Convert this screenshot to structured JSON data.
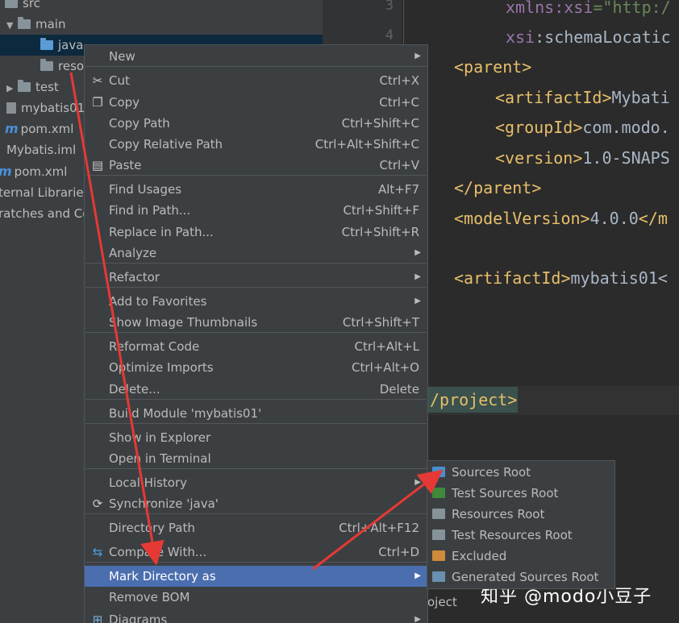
{
  "project_tree": {
    "items": [
      {
        "label": "src",
        "icon": "folder-icon"
      },
      {
        "label": "main",
        "icon": "folder-icon",
        "expanded": true
      },
      {
        "label": "java",
        "icon": "source-folder-icon",
        "selected": true
      },
      {
        "label": "reso",
        "icon": "folder-icon"
      },
      {
        "label": "test",
        "icon": "folder-icon",
        "expanded": false
      },
      {
        "label": "mybatis01",
        "icon": "file-icon"
      },
      {
        "label": "pom.xml",
        "icon": "maven-icon"
      },
      {
        "label": "Mybatis.iml",
        "icon": "iml-file-icon"
      },
      {
        "label": "pom.xml",
        "icon": "maven-icon"
      },
      {
        "label": "ternal Libraries",
        "icon": ""
      },
      {
        "label": "ratches and Co",
        "icon": ""
      }
    ]
  },
  "editor": {
    "line_numbers": [
      "3",
      "4"
    ],
    "lines": [
      {
        "parts": [
          {
            "t": "xmlns:",
            "c": "ns"
          },
          {
            "t": "xsi",
            "c": "ns"
          },
          {
            "t": "=\"http:/",
            "c": "str"
          }
        ]
      },
      {
        "parts": [
          {
            "t": "xsi",
            "c": "ns"
          },
          {
            "t": ":schemaLocatic",
            "c": "txt"
          }
        ]
      },
      {
        "parts": [
          {
            "t": "<parent>",
            "c": "tag"
          }
        ]
      },
      {
        "parts": [
          {
            "t": "<artifactId>",
            "c": "tag"
          },
          {
            "t": "Mybati",
            "c": "txt"
          }
        ]
      },
      {
        "parts": [
          {
            "t": "<groupId>",
            "c": "tag"
          },
          {
            "t": "com.modo.",
            "c": "txt"
          }
        ]
      },
      {
        "parts": [
          {
            "t": "<version>",
            "c": "tag"
          },
          {
            "t": "1.0-SNAPS",
            "c": "txt"
          }
        ]
      },
      {
        "parts": [
          {
            "t": "</parent>",
            "c": "tag"
          }
        ]
      },
      {
        "parts": [
          {
            "t": "<modelVersion>",
            "c": "tag"
          },
          {
            "t": "4.0.0",
            "c": "txt"
          },
          {
            "t": "</m",
            "c": "tag"
          }
        ]
      },
      {
        "parts": [
          {
            "t": "<artifactId>",
            "c": "tag"
          },
          {
            "t": "mybatis01<",
            "c": "txt"
          }
        ]
      },
      {
        "parts": [
          {
            "t": "/project>",
            "c": "tag"
          }
        ]
      }
    ],
    "bottom_label": "oject",
    "watermark": "知乎 @modo小豆子"
  },
  "context_menu": {
    "items": [
      {
        "label": "New",
        "shortcut": "",
        "submenu": true,
        "icon": ""
      },
      {
        "label": "Cut",
        "shortcut": "Ctrl+X",
        "icon": "scissors-icon"
      },
      {
        "label": "Copy",
        "shortcut": "Ctrl+C",
        "icon": "copy-icon"
      },
      {
        "label": "Copy Path",
        "shortcut": "Ctrl+Shift+C",
        "icon": ""
      },
      {
        "label": "Copy Relative Path",
        "shortcut": "Ctrl+Alt+Shift+C",
        "icon": ""
      },
      {
        "label": "Paste",
        "shortcut": "Ctrl+V",
        "icon": "paste-icon"
      },
      {
        "label": "Find Usages",
        "shortcut": "Alt+F7",
        "icon": ""
      },
      {
        "label": "Find in Path...",
        "shortcut": "Ctrl+Shift+F",
        "icon": ""
      },
      {
        "label": "Replace in Path...",
        "shortcut": "Ctrl+Shift+R",
        "icon": ""
      },
      {
        "label": "Analyze",
        "shortcut": "",
        "submenu": true,
        "icon": ""
      },
      {
        "label": "Refactor",
        "shortcut": "",
        "submenu": true,
        "icon": ""
      },
      {
        "label": "Add to Favorites",
        "shortcut": "",
        "submenu": true,
        "icon": ""
      },
      {
        "label": "Show Image Thumbnails",
        "shortcut": "Ctrl+Shift+T",
        "icon": ""
      },
      {
        "label": "Reformat Code",
        "shortcut": "Ctrl+Alt+L",
        "icon": ""
      },
      {
        "label": "Optimize Imports",
        "shortcut": "Ctrl+Alt+O",
        "icon": ""
      },
      {
        "label": "Delete...",
        "shortcut": "Delete",
        "icon": ""
      },
      {
        "label": "Build Module 'mybatis01'",
        "shortcut": "",
        "icon": ""
      },
      {
        "label": "Show in Explorer",
        "shortcut": "",
        "icon": ""
      },
      {
        "label": "Open in Terminal",
        "shortcut": "",
        "icon": ""
      },
      {
        "label": "Local History",
        "shortcut": "",
        "submenu": true,
        "icon": ""
      },
      {
        "label": "Synchronize 'java'",
        "shortcut": "",
        "icon": "sync-icon"
      },
      {
        "label": "Directory Path",
        "shortcut": "Ctrl+Alt+F12",
        "icon": ""
      },
      {
        "label": "Compare With...",
        "shortcut": "Ctrl+D",
        "icon": "compare-icon"
      },
      {
        "label": "Mark Directory as",
        "shortcut": "",
        "submenu": true,
        "active": true,
        "icon": ""
      },
      {
        "label": "Remove BOM",
        "shortcut": "",
        "icon": ""
      },
      {
        "label": "Diagrams",
        "shortcut": "",
        "submenu": true,
        "icon": "diagram-icon"
      }
    ]
  },
  "submenu": {
    "items": [
      {
        "label": "Sources Root",
        "color": "#4a8fd0"
      },
      {
        "label": "Test Sources Root",
        "color": "#3f8a3a"
      },
      {
        "label": "Resources Root",
        "color": "#87939a"
      },
      {
        "label": "Test Resources Root",
        "color": "#87939a"
      },
      {
        "label": "Excluded",
        "color": "#d08a3a"
      },
      {
        "label": "Generated Sources Root",
        "color": "#6a8fb0"
      }
    ]
  },
  "colors": {
    "arrow": "#e53935",
    "selection": "#4b6eaf"
  }
}
